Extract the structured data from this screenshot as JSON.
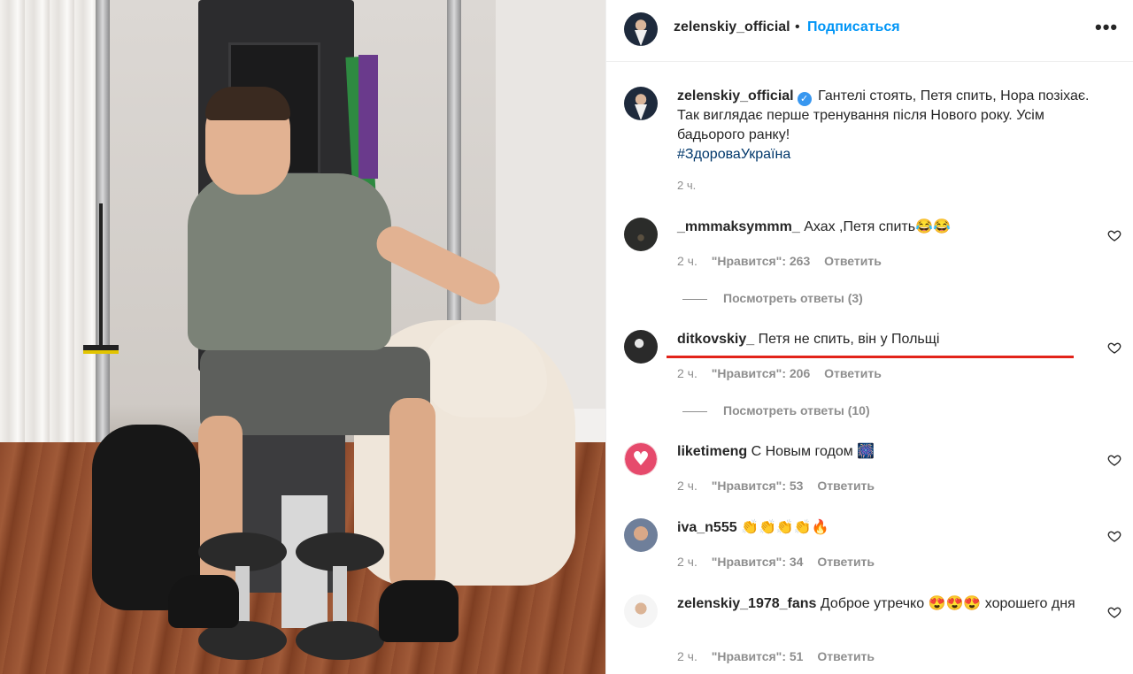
{
  "header": {
    "username": "zelenskiy_official",
    "separator": "•",
    "follow_label": "Подписаться",
    "more_label": "•••"
  },
  "caption": {
    "username": "zelenskiy_official",
    "verified_glyph": "✓",
    "text": "Гантелі стоять, Петя спить, Нора позіхає. Так виглядає перше тренування після Нового року. Усім бадьорого ранку!",
    "hashtag": "#ЗдороваУкраїна",
    "time": "2 ч."
  },
  "comments": [
    {
      "username": "_mmmaksymmm_",
      "text": "Ахах ,Петя спить😂😂",
      "time": "2 ч.",
      "likes": "\"Нравится\": 263",
      "reply_label": "Ответить",
      "view_replies": "Посмотреть ответы (3)"
    },
    {
      "username": "ditkovskiy_",
      "text": "Петя не спить, він у Польщі",
      "time": "2 ч.",
      "likes": "\"Нравится\": 206",
      "reply_label": "Ответить",
      "view_replies": "Посмотреть ответы (10)"
    },
    {
      "username": "liketimeng",
      "text": "С Новым годом 🎆",
      "time": "2 ч.",
      "likes": "\"Нравится\": 53",
      "reply_label": "Ответить"
    },
    {
      "username": "iva_n555",
      "text": "👏👏👏👏🔥",
      "time": "2 ч.",
      "likes": "\"Нравится\": 34",
      "reply_label": "Ответить"
    },
    {
      "username": "zelenskiy_1978_fans",
      "text": "Доброе утречко 😍😍😍 хорошего дня",
      "time": "2 ч.",
      "likes": "\"Нравится\": 51",
      "reply_label": "Ответить"
    }
  ],
  "icons": {
    "heart_outline": "heart-icon",
    "liketimeng_avatar_glyph": "♥"
  },
  "colors": {
    "link_blue": "#0095f6",
    "hashtag": "#00376b",
    "muted": "#8e8e8e",
    "highlight_red": "#e2231a"
  }
}
